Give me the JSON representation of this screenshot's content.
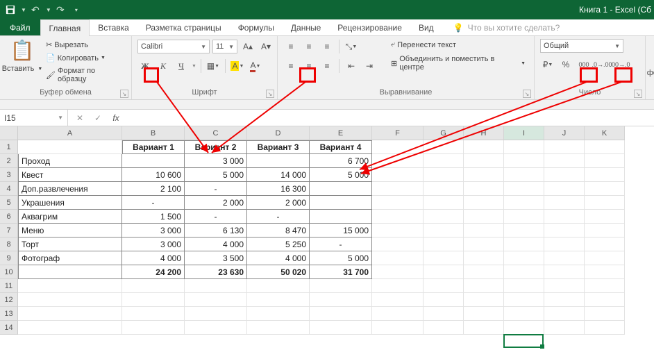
{
  "title": "Книга 1 - Excel (Сб",
  "qat": {
    "save": "save",
    "undo": "↶",
    "redo": "↷"
  },
  "menu": {
    "file": "Файл",
    "tabs": [
      "Главная",
      "Вставка",
      "Разметка страницы",
      "Формулы",
      "Данные",
      "Рецензирование",
      "Вид"
    ],
    "active": 0,
    "tellme": "Что вы хотите сделать?"
  },
  "ribbon": {
    "clipboard": {
      "paste": "Вставить",
      "cut": "Вырезать",
      "copy": "Копировать",
      "format_painter": "Формат по образцу",
      "label": "Буфер обмена"
    },
    "font": {
      "name": "Calibri",
      "size": "11",
      "bold": "Ж",
      "italic": "К",
      "underline": "Ч",
      "label": "Шрифт"
    },
    "align": {
      "wrap": "Перенести текст",
      "merge": "Объединить и поместить в центре",
      "label": "Выравнивание"
    },
    "number": {
      "format": "Общий",
      "thousands": "000",
      "inc": ".00→.0",
      "label": "Число",
      "extra": "фор"
    }
  },
  "namebox": "I15",
  "fx_label": "fx",
  "columns": [
    "A",
    "B",
    "C",
    "D",
    "E",
    "F",
    "G",
    "H",
    "I",
    "J",
    "K"
  ],
  "rows_shown": 14,
  "active_cell": "I15",
  "table": {
    "headers": [
      "",
      "Вариант 1",
      "Вариант 2",
      "Вариант 3",
      "Вариант 4"
    ],
    "row_labels": [
      "Проход",
      "Квест",
      "Доп.развлечения",
      "Украшения",
      "Аквагрим",
      "Меню",
      "Торт",
      "Фотограф"
    ],
    "data": [
      [
        "",
        "3 000",
        "",
        "6 700"
      ],
      [
        "10 600",
        "5 000",
        "14 000",
        "5 000"
      ],
      [
        "2 100",
        "-",
        "16 300",
        ""
      ],
      [
        "-",
        "2 000",
        "2 000",
        ""
      ],
      [
        "1 500",
        "-",
        "-",
        ""
      ],
      [
        "3 000",
        "6 130",
        "8 470",
        "15 000"
      ],
      [
        "3 000",
        "4 000",
        "5 250",
        "-"
      ],
      [
        "4 000",
        "3 500",
        "4 000",
        "5 000"
      ]
    ],
    "totals": [
      "24 200",
      "23 630",
      "50 020",
      "31 700"
    ]
  }
}
